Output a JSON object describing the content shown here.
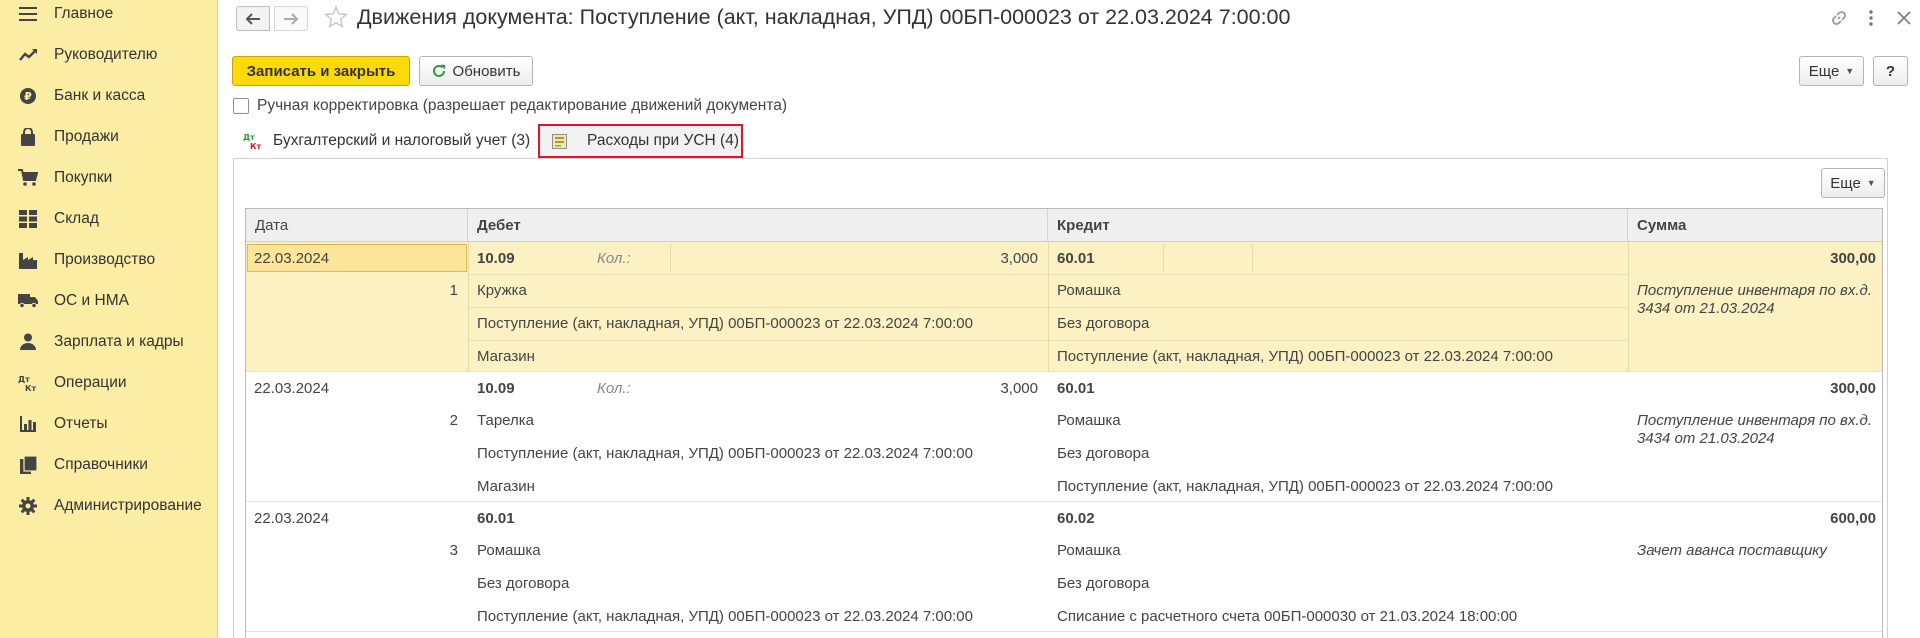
{
  "sidebar": {
    "items": [
      {
        "label": "Главное",
        "icon": "menu-icon"
      },
      {
        "label": "Руководителю",
        "icon": "trend-icon"
      },
      {
        "label": "Банк и касса",
        "icon": "ruble-coin-icon"
      },
      {
        "label": "Продажи",
        "icon": "shopping-bag-icon"
      },
      {
        "label": "Покупки",
        "icon": "cart-icon"
      },
      {
        "label": "Склад",
        "icon": "warehouse-icon"
      },
      {
        "label": "Производство",
        "icon": "factory-icon"
      },
      {
        "label": "ОС и НМА",
        "icon": "truck-icon"
      },
      {
        "label": "Зарплата и кадры",
        "icon": "person-icon"
      },
      {
        "label": "Операции",
        "icon": "dt-kt-icon"
      },
      {
        "label": "Отчеты",
        "icon": "bar-chart-icon"
      },
      {
        "label": "Справочники",
        "icon": "books-icon"
      },
      {
        "label": "Администрирование",
        "icon": "gear-icon"
      }
    ]
  },
  "header": {
    "title": "Движения документа: Поступление (акт, накладная, УПД) 00БП-000023 от 22.03.2024 7:00:00"
  },
  "toolbar": {
    "save_close_label": "Записать и закрыть",
    "refresh_label": "Обновить",
    "more_label": "Еще",
    "help_label": "?"
  },
  "manual_edit": {
    "label": "Ручная корректировка (разрешает редактирование движений документа)",
    "checked": false
  },
  "tabs": [
    {
      "label": "Бухгалтерский и налоговый учет (3)",
      "icon": "dt-kt-icon"
    },
    {
      "label": "Расходы при УСН (4)",
      "icon": "register-icon",
      "active": true
    }
  ],
  "table": {
    "more_label": "Еще",
    "columns": [
      "Дата",
      "Дебет",
      "Кредит",
      "Сумма"
    ],
    "rows": [
      {
        "date": "22.03.2024",
        "num": "1",
        "debit_account": "10.09",
        "qty_label": "Кол.:",
        "qty": "3,000",
        "debit_lines": [
          "Кружка",
          "Поступление (акт, накладная, УПД) 00БП-000023 от 22.03.2024 7:00:00",
          "Магазин"
        ],
        "credit_account": "60.01",
        "credit_lines": [
          "Ромашка",
          "Без договора",
          "Поступление (акт, накладная, УПД) 00БП-000023 от 22.03.2024 7:00:00"
        ],
        "amount": "300,00",
        "content": "Поступление инвентаря по вх.д. 3434 от 21.03.2024"
      },
      {
        "date": "22.03.2024",
        "num": "2",
        "debit_account": "10.09",
        "qty_label": "Кол.:",
        "qty": "3,000",
        "debit_lines": [
          "Тарелка",
          "Поступление (акт, накладная, УПД) 00БП-000023 от 22.03.2024 7:00:00",
          "Магазин"
        ],
        "credit_account": "60.01",
        "credit_lines": [
          "Ромашка",
          "Без договора",
          "Поступление (акт, накладная, УПД) 00БП-000023 от 22.03.2024 7:00:00"
        ],
        "amount": "300,00",
        "content": "Поступление инвентаря по вх.д. 3434 от 21.03.2024"
      },
      {
        "date": "22.03.2024",
        "num": "3",
        "debit_account": "60.01",
        "debit_lines": [
          "Ромашка",
          "Без договора",
          "Поступление (акт, накладная, УПД) 00БП-000023 от 22.03.2024 7:00:00"
        ],
        "credit_account": "60.02",
        "credit_lines": [
          "Ромашка",
          "Без договора",
          "Списание с расчетного счета 00БП-000030 от 21.03.2024 18:00:00"
        ],
        "amount": "600,00",
        "content": "Зачет аванса поставщику"
      }
    ]
  },
  "colors": {
    "sidebar_bg": "#fbeda4",
    "primary_button": "#fbd90c",
    "selected_row": "#fbf1c2",
    "active_tab_outline": "#d7192a"
  }
}
